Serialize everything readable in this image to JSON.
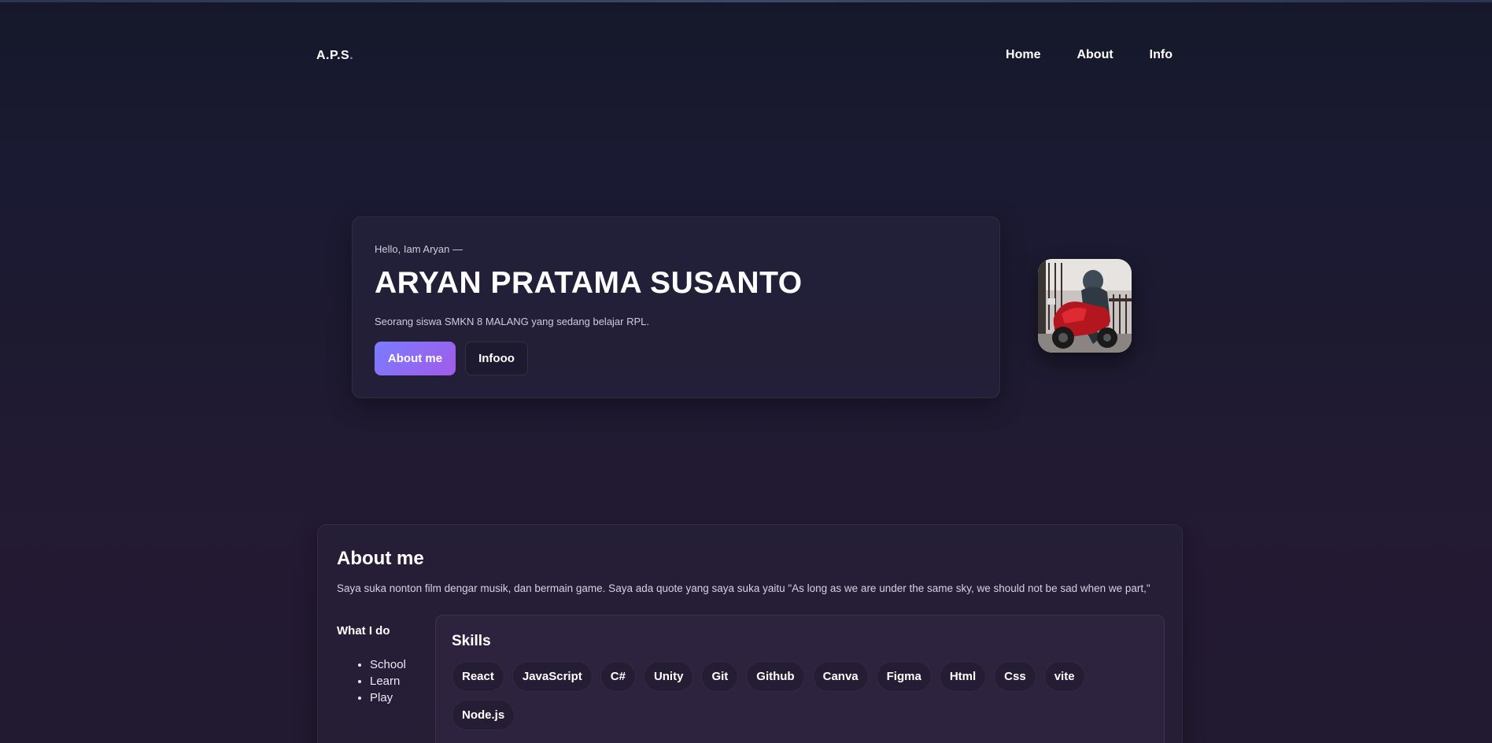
{
  "nav": {
    "logo": "A.P.S",
    "logo_dot": ".",
    "links": [
      {
        "label": "Home"
      },
      {
        "label": "About"
      },
      {
        "label": "Info"
      }
    ]
  },
  "hero": {
    "greeting": "Hello, Iam Aryan —",
    "name": "ARYAN PRATAMA SUSANTO",
    "subtitle": "Seorang siswa SMKN 8 MALANG yang sedang belajar RPL.",
    "primary_button": "About me",
    "secondary_button": "Infooo"
  },
  "about": {
    "title": "About me",
    "text": "Saya suka nonton film dengar musik, dan bermain game. Saya ada quote yang saya suka yaitu \"As long as we are under the same sky, we should not be sad when we part,\"",
    "what_i_do_title": "What I do",
    "what_i_do": [
      "School",
      "Learn",
      "Play"
    ],
    "skills_title": "Skills",
    "skills": [
      "React",
      "JavaScript",
      "C#",
      "Unity",
      "Git",
      "Github",
      "Canva",
      "Figma",
      "Html",
      "Css",
      "vite",
      "Node.js"
    ]
  },
  "colors": {
    "accent_start": "#7a7cff",
    "accent_end": "#a15be8",
    "background": "#1b1a33"
  }
}
